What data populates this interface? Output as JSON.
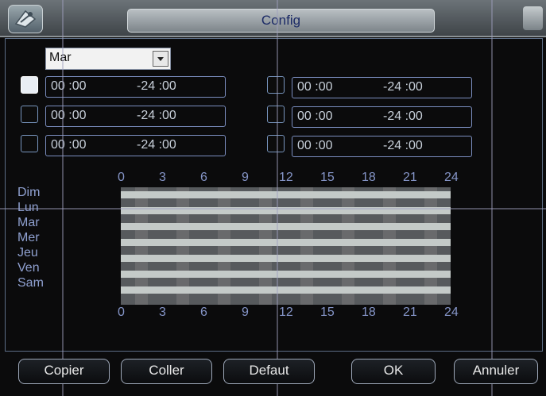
{
  "window": {
    "title": "Config"
  },
  "day_selector": {
    "value": "Mar"
  },
  "periods": [
    {
      "start": "00 :00",
      "end": "-24 :00",
      "checked": true
    },
    {
      "start": "00 :00",
      "end": "-24 :00",
      "checked": false
    },
    {
      "start": "00 :00",
      "end": "-24 :00",
      "checked": false
    },
    {
      "start": "00 :00",
      "end": "-24 :00",
      "checked": false
    },
    {
      "start": "00 :00",
      "end": "-24 :00",
      "checked": false
    },
    {
      "start": "00 :00",
      "end": "-24 :00",
      "checked": false
    }
  ],
  "schedule": {
    "days": [
      "Dim",
      "Lun",
      "Mar",
      "Mer",
      "Jeu",
      "Ven",
      "Sam"
    ],
    "hours": [
      "0",
      "3",
      "6",
      "9",
      "12",
      "15",
      "18",
      "21",
      "24"
    ]
  },
  "buttons": {
    "copy": "Copier",
    "paste": "Coller",
    "default": "Defaut",
    "ok": "OK",
    "cancel": "Annuler"
  }
}
